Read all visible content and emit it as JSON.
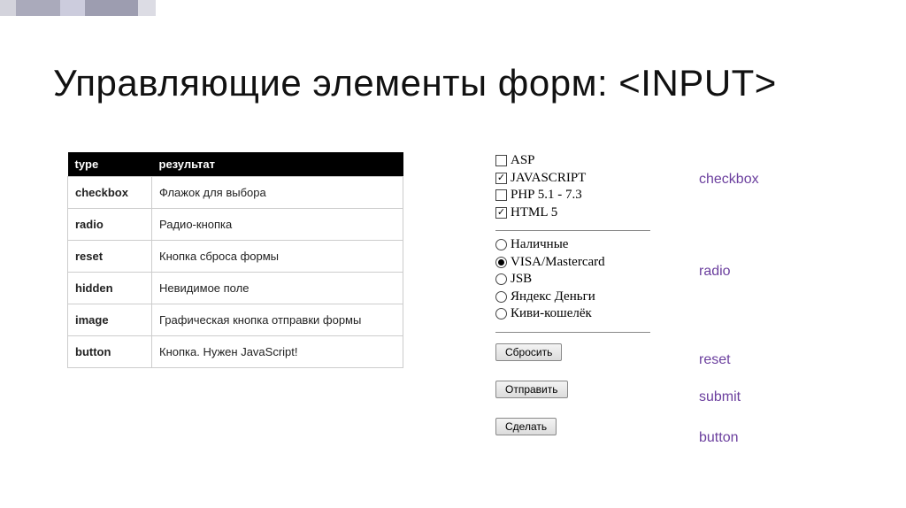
{
  "title": "Управляющие элементы форм: <INPUT>",
  "table": {
    "headers": [
      "type",
      "результат"
    ],
    "rows": [
      {
        "type": "checkbox",
        "desc": "Флажок для выбора"
      },
      {
        "type": "radio",
        "desc": "Радио-кнопка"
      },
      {
        "type": "reset",
        "desc": "Кнопка сброса формы"
      },
      {
        "type": "hidden",
        "desc": "Невидимое поле"
      },
      {
        "type": "image",
        "desc": "Графическая кнопка отправки формы"
      },
      {
        "type": "button",
        "desc": "Кнопка. Нужен JavaScript!"
      }
    ]
  },
  "checkboxes": [
    {
      "label": "ASP",
      "checked": false
    },
    {
      "label": "JAVASCRIPT",
      "checked": true
    },
    {
      "label": "PHP 5.1 - 7.3",
      "checked": false
    },
    {
      "label": "HTML 5",
      "checked": true
    }
  ],
  "radios": [
    {
      "label": "Наличные",
      "checked": false
    },
    {
      "label": "VISA/Mastercard",
      "checked": true
    },
    {
      "label": "JSB",
      "checked": false
    },
    {
      "label": "Яндекс Деньги",
      "checked": false
    },
    {
      "label": "Киви-кошелёк",
      "checked": false
    }
  ],
  "buttons": {
    "reset": "Сбросить",
    "submit": "Отправить",
    "button": "Сделать"
  },
  "annotations": {
    "checkbox": "checkbox",
    "radio": "radio",
    "reset": "reset",
    "submit": "submit",
    "button": "button"
  }
}
